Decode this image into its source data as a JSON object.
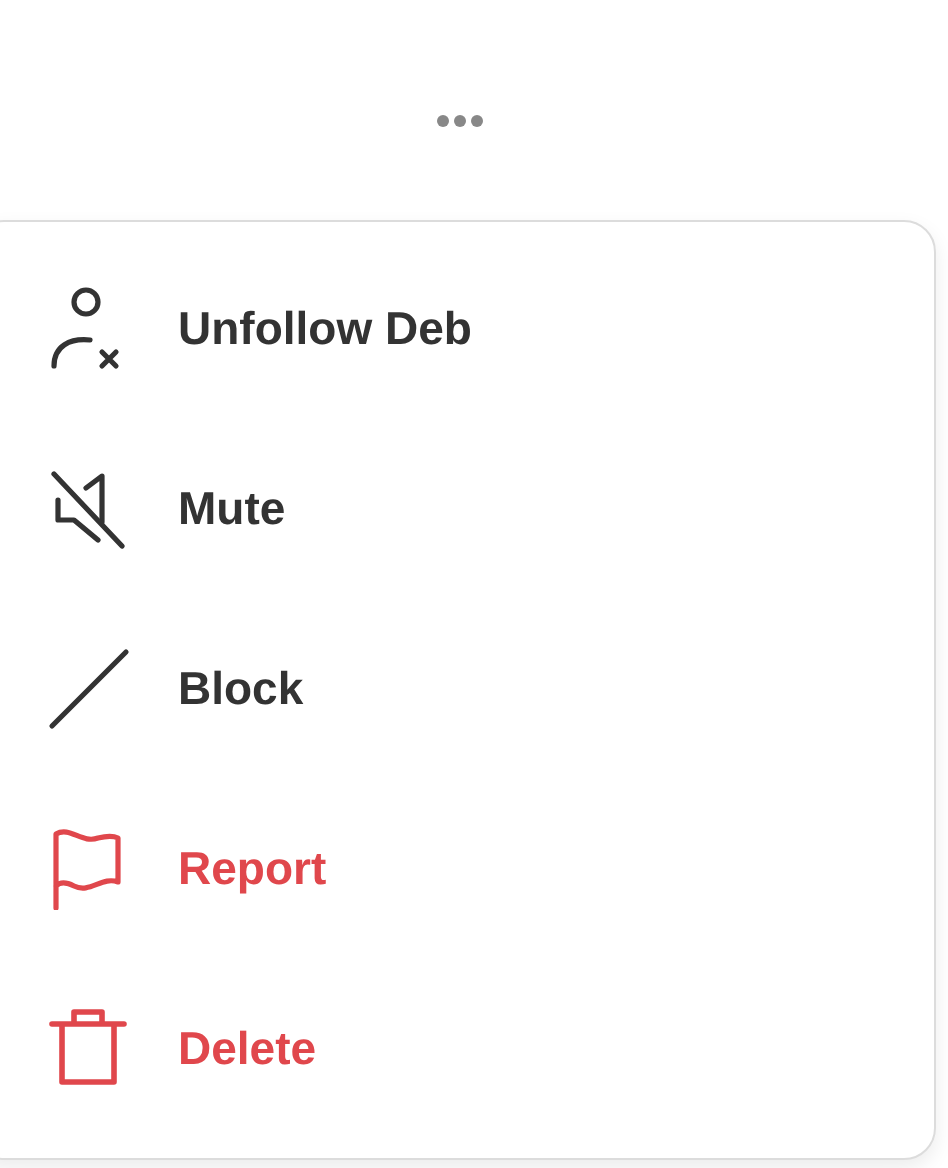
{
  "menu": {
    "items": [
      {
        "label": "Unfollow Deb",
        "kind": "default"
      },
      {
        "label": "Mute",
        "kind": "default"
      },
      {
        "label": "Block",
        "kind": "default"
      },
      {
        "label": "Report",
        "kind": "destructive"
      },
      {
        "label": "Delete",
        "kind": "destructive"
      }
    ]
  }
}
